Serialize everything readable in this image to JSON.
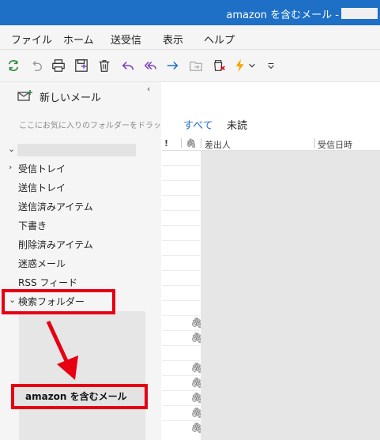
{
  "window": {
    "title": "amazon を含むメール -"
  },
  "menu": [
    "ファイル",
    "ホーム",
    "送受信",
    "表示",
    "ヘルプ"
  ],
  "toolbar": {
    "icons": [
      "sync-icon",
      "undo-icon",
      "print-icon",
      "save-icon",
      "delete-icon",
      "reply-icon",
      "reply-all-icon",
      "forward-icon",
      "move-icon",
      "junk-icon",
      "flag-lightning-icon",
      "dropdown-icon",
      "customize-icon"
    ]
  },
  "left_pane": {
    "new_mail": "新しいメール",
    "favorites_hint": "ここにお気に入りのフォルダーをドラッグ",
    "folders": [
      "受信トレイ",
      "送信トレイ",
      "送信済みアイテム",
      "下書き",
      "削除済みアイテム",
      "迷惑メール",
      "RSS フィード",
      "検索フォルダー"
    ],
    "selected_folder": "amazon を含むメール"
  },
  "message_list": {
    "tabs": [
      "すべて",
      "未読"
    ],
    "columns": {
      "importance": "!",
      "attachment": "🖇",
      "sender": "差出人",
      "received": "受信日時"
    }
  },
  "colors": {
    "title_bar": "#1e6fc6",
    "highlight_box": "#e60012",
    "accent_tab": "#1e6fc6"
  }
}
